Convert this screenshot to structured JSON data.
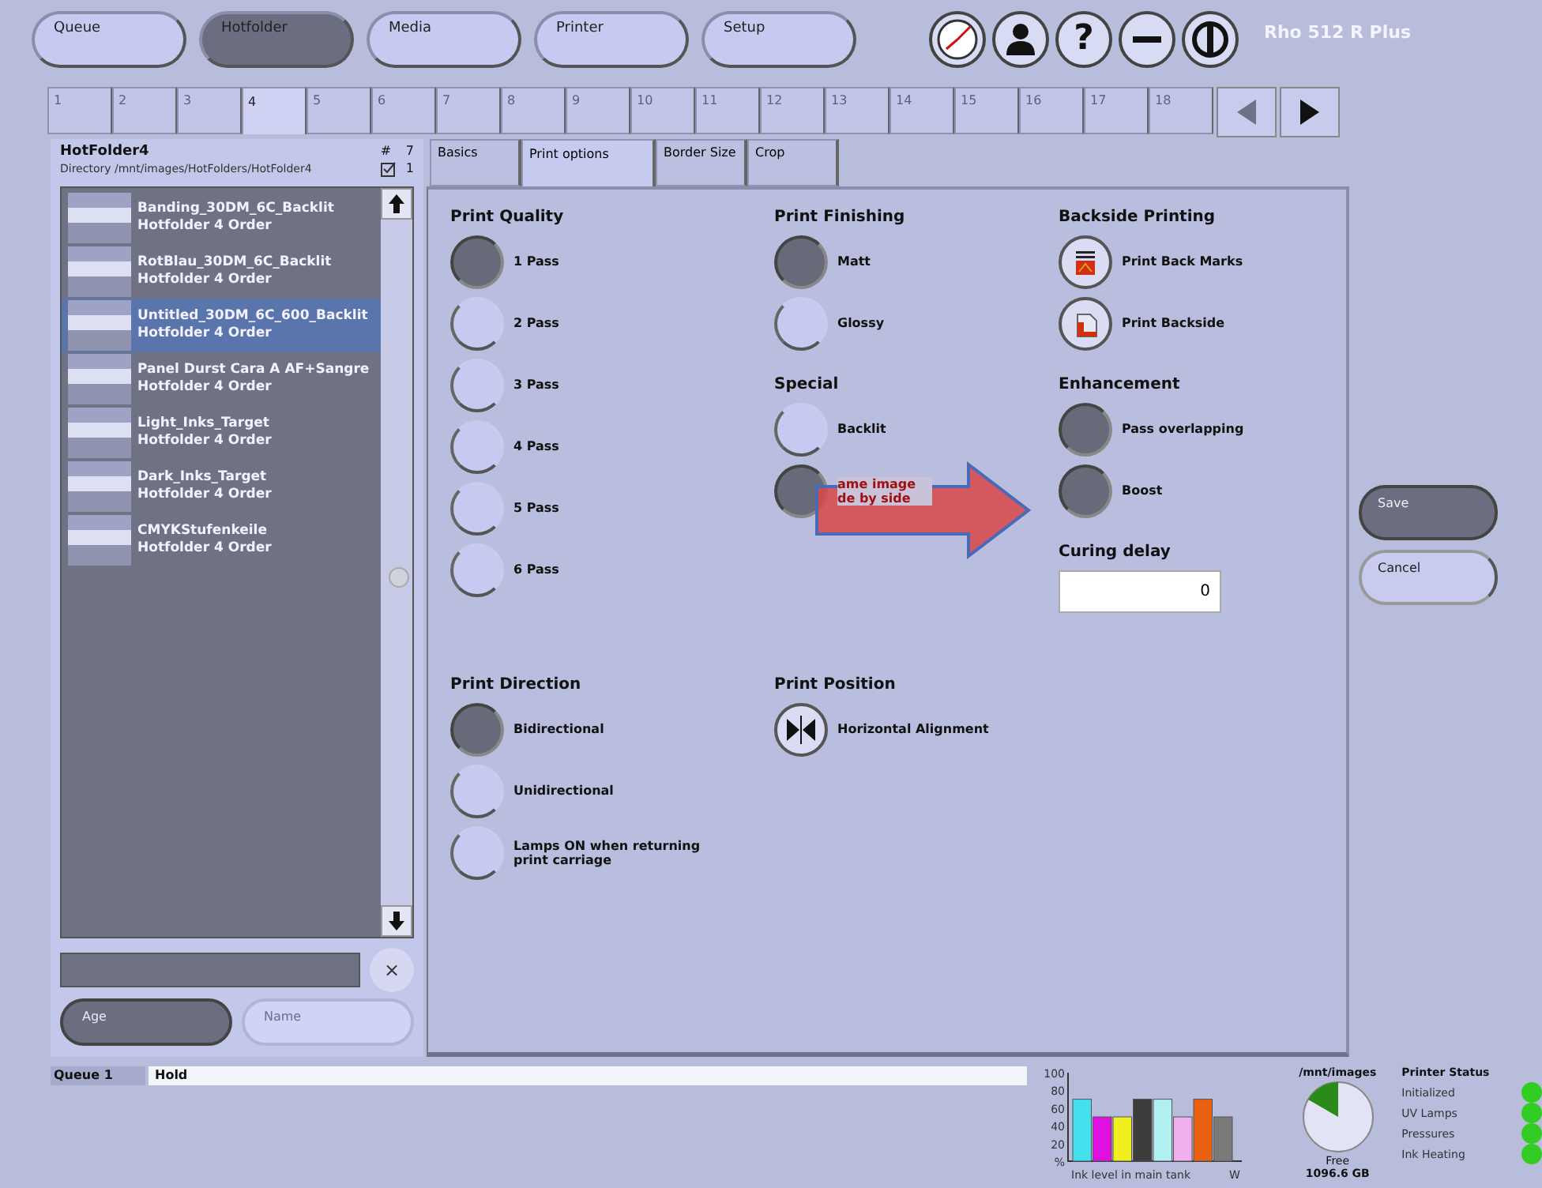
{
  "nav": {
    "buttons": [
      {
        "label": "Queue",
        "selected": false
      },
      {
        "label": "Hotfolder",
        "selected": true
      },
      {
        "label": "Media",
        "selected": false
      },
      {
        "label": "Printer",
        "selected": false
      },
      {
        "label": "Setup",
        "selected": false
      }
    ],
    "icon_buttons": [
      {
        "kind": "clock"
      },
      {
        "kind": "user"
      },
      {
        "kind": "glyph",
        "glyph": "?"
      },
      {
        "kind": "minimize"
      },
      {
        "kind": "power"
      }
    ],
    "brand": "Rho 512 R Plus"
  },
  "hotfolder_tabs": [
    {
      "label": "1",
      "selected": false
    },
    {
      "label": "2",
      "selected": false
    },
    {
      "label": "3",
      "selected": false
    },
    {
      "label": "4",
      "selected": true
    },
    {
      "label": "5",
      "selected": false
    },
    {
      "label": "6",
      "selected": false
    },
    {
      "label": "7",
      "selected": false
    },
    {
      "label": "8",
      "selected": false
    },
    {
      "label": "9",
      "selected": false
    },
    {
      "label": "10",
      "selected": false
    },
    {
      "label": "11",
      "selected": false
    },
    {
      "label": "12",
      "selected": false
    },
    {
      "label": "13",
      "selected": false
    },
    {
      "label": "14",
      "selected": false
    },
    {
      "label": "15",
      "selected": false
    },
    {
      "label": "16",
      "selected": false
    },
    {
      "label": "17",
      "selected": false
    },
    {
      "label": "18",
      "selected": false
    }
  ],
  "folder": {
    "title": "HotFolder4",
    "count_label": "#",
    "count": "7",
    "directory": "Directory /mnt/images/HotFolders/HotFolder4",
    "checked_count": "1",
    "items": [
      {
        "name": "Banding_30DM_6C_Backlit",
        "subtitle": "Hotfolder 4 Order",
        "selected": false
      },
      {
        "name": "RotBlau_30DM_6C_Backlit",
        "subtitle": "Hotfolder 4 Order",
        "selected": false
      },
      {
        "name": "Untitled_30DM_6C_600_Backlit",
        "subtitle": "Hotfolder 4 Order",
        "selected": true
      },
      {
        "name": "Panel Durst Cara A AF+Sangre",
        "subtitle": "Hotfolder 4 Order",
        "selected": false
      },
      {
        "name": "Light_Inks_Target",
        "subtitle": "Hotfolder 4 Order",
        "selected": false
      },
      {
        "name": "Dark_Inks_Target",
        "subtitle": "Hotfolder 4 Order",
        "selected": false
      },
      {
        "name": "CMYKStufenkeile",
        "subtitle": "Hotfolder 4 Order",
        "selected": false
      }
    ],
    "clear_button": "×",
    "sort": [
      {
        "label": "Age",
        "selected": true
      },
      {
        "label": "Name",
        "selected": false
      }
    ]
  },
  "options": {
    "tabs": [
      {
        "label": "Basics",
        "selected": false
      },
      {
        "label": "Print options",
        "selected": true
      },
      {
        "label": "Border Size",
        "selected": false
      },
      {
        "label": "Crop",
        "selected": false
      }
    ],
    "sections": [
      {
        "columns": [
          [
            {
              "title": "Print Quality",
              "options": [
                {
                  "kind": "radio",
                  "label": "1 Pass",
                  "selected": true
                },
                {
                  "kind": "radio",
                  "label": "2 Pass",
                  "selected": false
                },
                {
                  "kind": "radio",
                  "label": "3 Pass",
                  "selected": false
                },
                {
                  "kind": "radio",
                  "label": "4 Pass",
                  "selected": false
                },
                {
                  "kind": "radio",
                  "label": "5 Pass",
                  "selected": false
                },
                {
                  "kind": "radio",
                  "label": "6 Pass",
                  "selected": false
                }
              ]
            }
          ],
          [
            {
              "title": "Print Finishing",
              "options": [
                {
                  "kind": "radio",
                  "label": "Matt",
                  "selected": true
                },
                {
                  "kind": "radio",
                  "label": "Glossy",
                  "selected": false
                }
              ]
            },
            {
              "title": "Special",
              "options": [
                {
                  "kind": "radio",
                  "label": "Backlit",
                  "selected": false
                },
                {
                  "kind": "radio",
                  "label": "ame image de by side",
                  "selected": true
                }
              ]
            }
          ],
          [
            {
              "title": "Backside Printing",
              "options": [
                {
                  "kind": "icon",
                  "label": "Print Back Marks"
                },
                {
                  "kind": "icon",
                  "label": "Print Backside"
                }
              ]
            },
            {
              "title": "Enhancement",
              "options": [
                {
                  "kind": "radio",
                  "label": "Pass overlapping",
                  "selected": true
                },
                {
                  "kind": "radio",
                  "label": "Boost",
                  "selected": true
                }
              ]
            },
            {
              "title": "Curing delay",
              "field": {
                "value": "0"
              }
            }
          ]
        ]
      },
      {
        "columns": [
          [
            {
              "title": "Print Direction",
              "options": [
                {
                  "kind": "radio",
                  "label": "Bidirectional",
                  "selected": true
                },
                {
                  "kind": "radio",
                  "label": "Unidirectional",
                  "selected": false
                },
                {
                  "kind": "radio",
                  "label": "Lamps ON when returning print carriage",
                  "selected": false
                }
              ]
            }
          ],
          [
            {
              "title": "Print Position",
              "options": [
                {
                  "kind": "icon",
                  "label": "Horizontal Alignment"
                }
              ]
            }
          ]
        ]
      }
    ]
  },
  "actions": [
    {
      "label": "Save",
      "highlighted": true
    },
    {
      "label": "Cancel",
      "highlighted": false
    }
  ],
  "status": {
    "queue_label": "Queue 1",
    "state": "Hold"
  },
  "ink": {
    "chart_data": {
      "type": "bar",
      "xlabel": "Ink level in main tank",
      "ylim": [
        0,
        100
      ],
      "yticks": [
        {
          "value": 0,
          "label": "%"
        },
        20,
        40,
        60,
        80,
        100
      ],
      "series": [
        {
          "color": "#44e0ee",
          "values": [
            70,
            null,
            null,
            null,
            null,
            null,
            null,
            null
          ]
        },
        {
          "color": "#e010e0",
          "values": [
            null,
            50,
            null,
            null,
            null,
            null,
            null,
            null
          ]
        },
        {
          "color": "#f0f020",
          "values": [
            null,
            null,
            50,
            null,
            null,
            null,
            null,
            null
          ]
        },
        {
          "color": "#3c3c3c",
          "values": [
            null,
            null,
            null,
            70,
            null,
            null,
            null,
            null
          ]
        },
        {
          "color": "#b0f0f0",
          "values": [
            null,
            null,
            null,
            null,
            70,
            null,
            null,
            null
          ]
        },
        {
          "color": "#f0b0f0",
          "values": [
            null,
            null,
            null,
            null,
            null,
            50,
            null,
            null
          ]
        },
        {
          "color": "#e86010",
          "values": [
            null,
            null,
            null,
            null,
            null,
            null,
            70,
            null
          ]
        },
        {
          "color": "#7a7a7a",
          "values": [
            null,
            null,
            null,
            null,
            null,
            null,
            null,
            50
          ]
        }
      ],
      "annotations": [
        {
          "text": "W"
        }
      ]
    }
  },
  "disk": {
    "path": "/mnt/images",
    "free_label": "Free",
    "free": "1096.6 GB"
  },
  "printer_status": {
    "title": "Printer Status",
    "items": [
      {
        "label": "Initialized",
        "color": "#33cc22"
      },
      {
        "label": "UV Lamps",
        "color": "#33cc22"
      },
      {
        "label": "Pressures",
        "color": "#33cc22"
      },
      {
        "label": "Ink Heating",
        "color": "#33cc22"
      }
    ]
  }
}
